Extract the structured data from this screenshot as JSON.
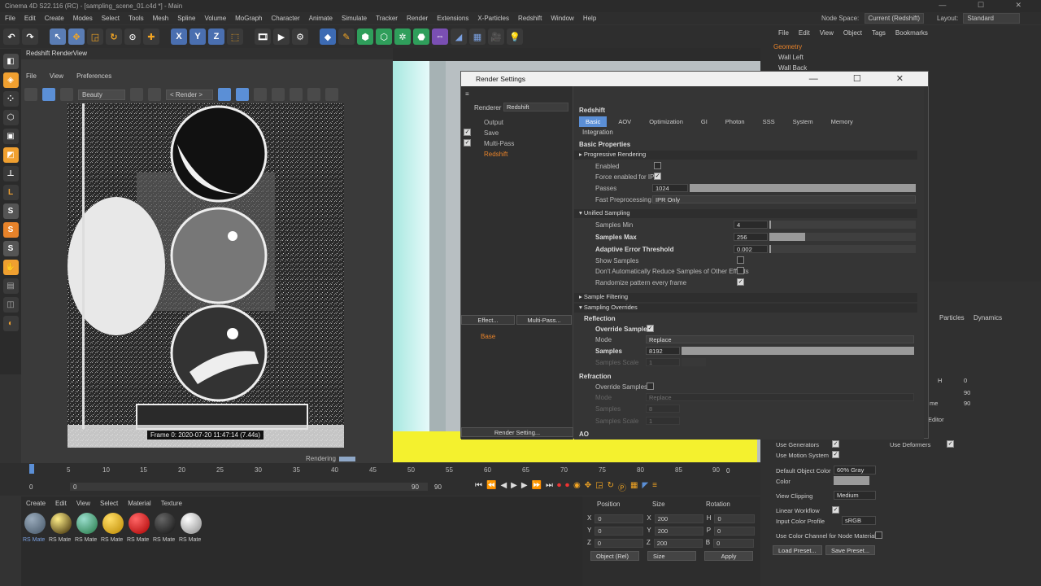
{
  "app": {
    "title": "Cinema 4D S22.116 (RC) - [sampling_scene_01.c4d *] - Main",
    "window_controls": "— ☐ ✕"
  },
  "menubar": [
    "File",
    "Edit",
    "Create",
    "Modes",
    "Select",
    "Tools",
    "Mesh",
    "Spline",
    "Volume",
    "MoGraph",
    "Character",
    "Animate",
    "Simulate",
    "Tracker",
    "Render",
    "Extensions",
    "X-Particles",
    "Redshift",
    "Window",
    "Help"
  ],
  "node_space": {
    "label": "Node Space:",
    "value": "Current (Redshift)"
  },
  "layout": {
    "label": "Layout:",
    "value": "Standard"
  },
  "toolbar": {
    "axis_labels": [
      "X",
      "Y",
      "Z"
    ]
  },
  "lefttools": {
    "s_labels": [
      "S",
      "S",
      "S"
    ]
  },
  "render_view": {
    "title": "Redshift RenderView",
    "menu": [
      "File",
      "View",
      "Preferences"
    ],
    "aov_dropdown": "Beauty",
    "render_dropdown": "< Render >",
    "frame_label": "Frame  0:  2020-07-20  11:47:14  (7.44s)",
    "status": "Rendering"
  },
  "render_settings": {
    "title": "Render Settings",
    "renderer_label": "Renderer",
    "renderer_value": "Redshift",
    "tree": [
      "Output",
      "Save",
      "Multi-Pass",
      "Redshift"
    ],
    "effect_button": "Effect...",
    "multipass_button": "Multi-Pass...",
    "base_item": "Base",
    "footer_button": "Render Setting...",
    "header": "Redshift",
    "tabs": [
      "Basic",
      "AOV",
      "Optimization",
      "GI",
      "Photon",
      "SSS",
      "System",
      "Memory"
    ],
    "tab2": "Integration",
    "basic_properties": "Basic Properties",
    "progressive": {
      "header": "Progressive Rendering",
      "enabled": "Enabled",
      "force_ipr": "Force enabled for IPR",
      "passes_label": "Passes",
      "passes_value": "1024",
      "fast_preprocessing_label": "Fast Preprocessing",
      "fast_preprocessing_value": "IPR Only"
    },
    "unified": {
      "header": "Unified Sampling",
      "samples_min_label": "Samples Min",
      "samples_min_value": "4",
      "samples_max_label": "Samples Max",
      "samples_max_value": "256",
      "aet_label": "Adaptive Error Threshold",
      "aet_value": "0.002",
      "show_samples": "Show Samples",
      "dont_reduce": "Don't Automatically Reduce Samples of Other Effects",
      "randomize": "Randomize pattern every frame"
    },
    "sample_filtering": "Sample Filtering",
    "sampling_overrides": "Sampling Overrides",
    "reflection": {
      "header": "Reflection",
      "override_samples": "Override Samples",
      "mode_label": "Mode",
      "mode_value": "Replace",
      "samples_label": "Samples",
      "samples_value": "8192",
      "samples_scale_label": "Samples Scale",
      "samples_scale_value": "1"
    },
    "refraction": {
      "header": "Refraction",
      "override_samples": "Override Samples",
      "mode_label": "Mode",
      "mode_value": "Replace",
      "samples_label": "Samples",
      "samples_value": "8",
      "samples_scale_label": "Samples Scale",
      "samples_scale_value": "1"
    },
    "ao_header": "AO"
  },
  "object_manager": {
    "menu": [
      "File",
      "Edit",
      "View",
      "Object",
      "Tags",
      "Bookmarks"
    ],
    "items": [
      "Geometry",
      "Wall Left",
      "Wall Back"
    ]
  },
  "attributes": {
    "tabs": [
      "Particles",
      "Dynamics"
    ],
    "fields": [
      {
        "label": "Use Generators",
        "checked": true
      },
      {
        "label": "Use Motion System",
        "checked": true
      }
    ],
    "use_deformers": "Use Deformers",
    "default_object_color_label": "Default Object Color",
    "default_object_color_value": "60% Gray",
    "color_label": "Color",
    "view_clipping_label": "View Clipping",
    "view_clipping_value": "Medium",
    "linear_workflow": "Linear Workflow",
    "input_color_profile_label": "Input Color Profile",
    "input_color_profile_value": "sRGB",
    "use_color_channel": "Use Color Channel for Node Material",
    "load_preset": "Load Preset...",
    "save_preset": "Save Preset...",
    "editor": "Editor",
    "num0": "0",
    "num90a": "90",
    "num90b": "90",
    "lbl_h": "H",
    "lbl_me": "me"
  },
  "timeline": {
    "ticks": [
      "0",
      "5",
      "10",
      "15",
      "20",
      "25",
      "30",
      "35",
      "40",
      "45",
      "50",
      "55",
      "60",
      "65",
      "70",
      "75",
      "80",
      "85",
      "90"
    ],
    "start": "0",
    "current": "0",
    "end": "90",
    "end2": "90",
    "endframe": "0"
  },
  "materials": {
    "menu": [
      "Create",
      "Edit",
      "View",
      "Select",
      "Material",
      "Texture"
    ],
    "items": [
      "RS Mate",
      "RS Mate",
      "RS Mate",
      "RS Mate",
      "RS Mate",
      "RS Mate",
      "RS Mate"
    ]
  },
  "coordinates": {
    "headers": [
      "Position",
      "Size",
      "Rotation"
    ],
    "rows": [
      {
        "axis": "X",
        "pos": "0",
        "size_axis": "X",
        "size": "200",
        "rot_axis": "H",
        "rot": "0"
      },
      {
        "axis": "Y",
        "pos": "0",
        "size_axis": "Y",
        "size": "200",
        "rot_axis": "P",
        "rot": "0"
      },
      {
        "axis": "Z",
        "pos": "0",
        "size_axis": "Z",
        "size": "200",
        "rot_axis": "B",
        "rot": "0"
      }
    ],
    "mode": "Object (Rel)",
    "size_mode": "Size",
    "apply": "Apply"
  },
  "colors": {
    "accent": "#5b8fd6",
    "highlight": "#f4a623",
    "orange_text": "#e8832a",
    "viewport_yellow": "#f4f12e"
  }
}
